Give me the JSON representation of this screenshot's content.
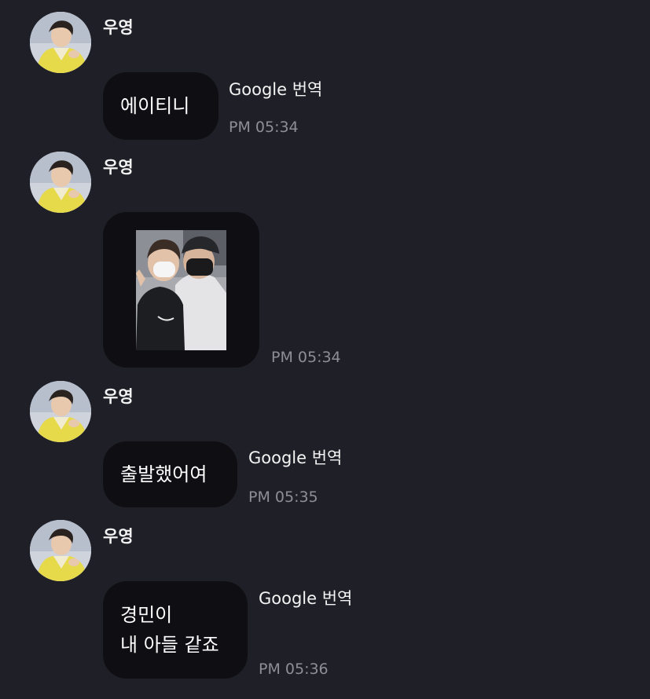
{
  "messages": [
    {
      "sender": "우영",
      "text": "에이티니",
      "translate_label": "Google 번역",
      "time": "PM 05:34"
    },
    {
      "sender": "우영",
      "image_alt": "photo",
      "time": "PM 05:34"
    },
    {
      "sender": "우영",
      "text": "출발했어여",
      "translate_label": "Google 번역",
      "time": "PM 05:35"
    },
    {
      "sender": "우영",
      "text": "경민이\n내 아들 같죠",
      "translate_label": "Google 번역",
      "time": "PM 05:36"
    }
  ],
  "colors": {
    "background": "#1f1f27",
    "bubble": "#0f0f13",
    "time": "#8e8e96",
    "avatar_jacket": "#e6d94a"
  },
  "icons": {
    "avatar": "profile-photo"
  }
}
